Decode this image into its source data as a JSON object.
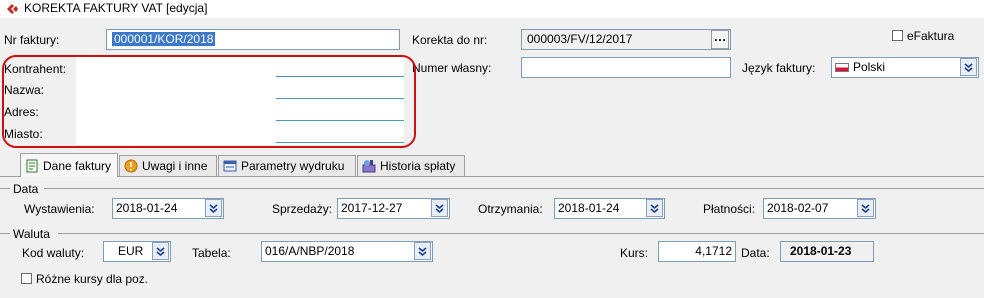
{
  "window": {
    "title": "KOREKTA FAKTURY VAT  [edycja]"
  },
  "header": {
    "invoice_no_label": "Nr faktury:",
    "invoice_no_value": "000001/KOR/2018",
    "correction_to_label": "Korekta do nr:",
    "correction_to_value": "000003/FV/12/2017",
    "own_number_label": "Numer własny:",
    "own_number_value": "",
    "efaktura_label": "eFaktura",
    "efaktura_checked": false,
    "language_label": "Język faktury:",
    "language_value": "Polski"
  },
  "contractor": {
    "contractor_label": "Kontrahent:",
    "name_label": "Nazwa:",
    "address_label": "Adres:",
    "city_label": "Miasto:"
  },
  "tabs": [
    {
      "label": "Dane faktury",
      "icon": "document-icon",
      "active": true
    },
    {
      "label": "Uwagi i inne",
      "icon": "info-icon",
      "active": false
    },
    {
      "label": "Parametry wydruku",
      "icon": "print-settings-icon",
      "active": false
    },
    {
      "label": "Historia spłaty",
      "icon": "payment-history-icon",
      "active": false
    }
  ],
  "dates": {
    "group_label": "Data",
    "issue_label": "Wystawienia:",
    "issue_value": "2018-01-24",
    "sale_label": "Sprzedaży:",
    "sale_value": "2017-12-27",
    "received_label": "Otrzymania:",
    "received_value": "2018-01-24",
    "payment_label": "Płatności:",
    "payment_value": "2018-02-07"
  },
  "currency": {
    "group_label": "Waluta",
    "code_label": "Kod waluty:",
    "code_value": "EUR",
    "table_label": "Tabela:",
    "table_value": "016/A/NBP/2018",
    "rate_label": "Kurs:",
    "rate_value": "4,1712",
    "date_label": "Data:",
    "date_value": "2018-01-23",
    "different_rates_label": "Różne kursy dla poz.",
    "different_rates_checked": false
  },
  "colors": {
    "highlight_border": "#d01010",
    "selection": "#3c78c8"
  }
}
